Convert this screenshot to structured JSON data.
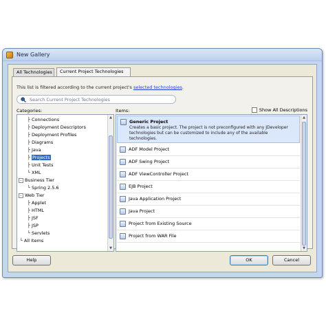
{
  "window": {
    "title": "New Gallery"
  },
  "tabs": [
    {
      "label": "All Technologies",
      "selected": false
    },
    {
      "label": "Current Project Technologies",
      "selected": true
    }
  ],
  "filter_note": {
    "text": "This list is filtered according to the current project's ",
    "link": "selected technologies",
    "suffix": "."
  },
  "search": {
    "placeholder": "Search Current Project Technologies",
    "value": ""
  },
  "categories": {
    "label": "Categories:",
    "tree": [
      {
        "label": "Connections",
        "depth": 2,
        "expander": ""
      },
      {
        "label": "Deployment Descriptors",
        "depth": 2,
        "expander": ""
      },
      {
        "label": "Deployment Profiles",
        "depth": 2,
        "expander": ""
      },
      {
        "label": "Diagrams",
        "depth": 2,
        "expander": ""
      },
      {
        "label": "Java",
        "depth": 2,
        "expander": ""
      },
      {
        "label": "Projects",
        "depth": 2,
        "expander": "",
        "selected": true
      },
      {
        "label": "Unit Tests",
        "depth": 2,
        "expander": ""
      },
      {
        "label": "XML",
        "depth": 2,
        "expander": ""
      },
      {
        "label": "Business Tier",
        "depth": 1,
        "expander": "-"
      },
      {
        "label": "Spring 2.5.6",
        "depth": 2,
        "expander": ""
      },
      {
        "label": "Web Tier",
        "depth": 1,
        "expander": "-"
      },
      {
        "label": "Applet",
        "depth": 2,
        "expander": ""
      },
      {
        "label": "HTML",
        "depth": 2,
        "expander": ""
      },
      {
        "label": "JSF",
        "depth": 2,
        "expander": ""
      },
      {
        "label": "JSP",
        "depth": 2,
        "expander": ""
      },
      {
        "label": "Servlets",
        "depth": 2,
        "expander": ""
      },
      {
        "label": "All Items",
        "depth": 1,
        "expander": ""
      }
    ]
  },
  "items": {
    "label": "Items:",
    "show_all_label": "Show All Descriptions",
    "show_all_checked": false,
    "list": [
      {
        "title": "Generic Project",
        "description": "Creates a basic project. The project is not preconfigured with any JDeveloper technologies but can be customized to include any of the available technologies.",
        "selected": true
      },
      {
        "title": "ADF Model Project",
        "description": ""
      },
      {
        "title": "ADF Swing Project",
        "description": ""
      },
      {
        "title": "ADF ViewController Project",
        "description": ""
      },
      {
        "title": "EJB Project",
        "description": ""
      },
      {
        "title": "Java Application Project",
        "description": ""
      },
      {
        "title": "Java Project",
        "description": ""
      },
      {
        "title": "Project from Existing Source",
        "description": ""
      },
      {
        "title": "Project from WAR File",
        "description": ""
      }
    ]
  },
  "buttons": {
    "help": "Help",
    "ok": "OK",
    "cancel": "Cancel"
  },
  "colors": {
    "accent": "#316ac5",
    "link": "#1a3fd0",
    "selection_bg": "#dbe8fb"
  }
}
